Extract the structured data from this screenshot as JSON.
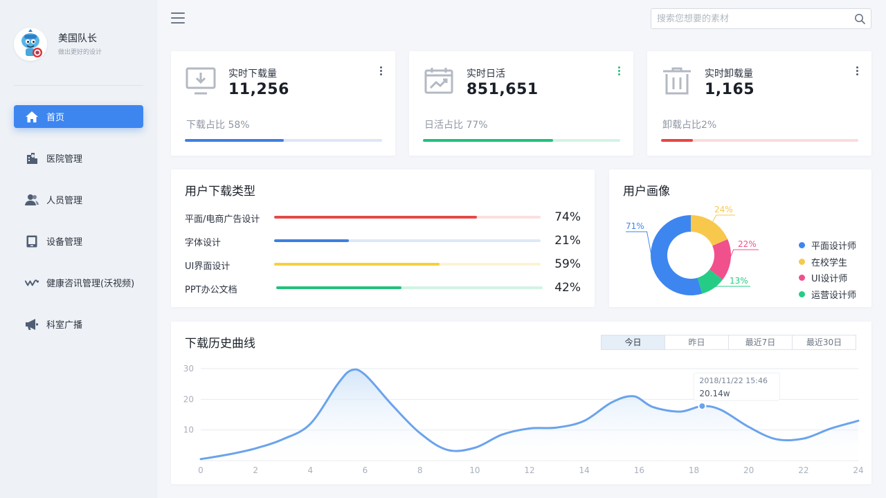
{
  "brand": {
    "name": "美国队长",
    "subtitle": "做出更好的设计"
  },
  "nav": {
    "items": [
      {
        "label": "首页",
        "icon": "home-icon"
      },
      {
        "label": "医院管理",
        "icon": "hospital-icon"
      },
      {
        "label": "人员管理",
        "icon": "users-icon"
      },
      {
        "label": "设备管理",
        "icon": "tablet-icon"
      },
      {
        "label": "健康咨讯管理(沃视频)",
        "icon": "wave-icon"
      },
      {
        "label": "科室广播",
        "icon": "megaphone-icon"
      }
    ],
    "active_index": 0
  },
  "search": {
    "placeholder": "搜索您想要的素材",
    "value": ""
  },
  "stats": [
    {
      "title": "实时下载量",
      "value": "11,256",
      "footer": "下载占比 58%",
      "progress": 0.5,
      "color": "#3d7fe0",
      "track": "#dce7f6",
      "icon": "download-monitor-icon"
    },
    {
      "title": "实时日活",
      "value": "851,651",
      "footer": "日活占比 77%",
      "progress": 0.66,
      "color": "#20c07a",
      "track": "#d3f3e4",
      "icon": "calendar-trend-icon"
    },
    {
      "title": "实时卸载量",
      "value": "1,165",
      "footer": "卸载占比2%",
      "progress": 0.16,
      "color": "#e64545",
      "track": "#fbdcdc",
      "icon": "trash-icon"
    }
  ],
  "download_types": {
    "title": "用户下载类型",
    "rows": [
      {
        "label": "平面/电商广告设计",
        "pct": "74%",
        "value": 0.76,
        "color": "#e34a4a",
        "track": "#fbdfdf"
      },
      {
        "label": "字体设计",
        "pct": "21%",
        "value": 0.28,
        "color": "#3d7fe0",
        "track": "#dde8f7"
      },
      {
        "label": "UI界面设计",
        "pct": "59%",
        "value": 0.62,
        "color": "#f4d13d",
        "track": "#fdf3d2"
      },
      {
        "label": "PPT办公文档",
        "pct": "42%",
        "value": 0.47,
        "color": "#22c17a",
        "track": "#d2f3e3"
      }
    ]
  },
  "persona": {
    "title": "用户画像",
    "slices": [
      {
        "name": "平面设计师",
        "label": "71%",
        "value": 71,
        "color": "#3d86f0"
      },
      {
        "name": "在校学生",
        "label": "24%",
        "value": 24,
        "color": "#f7c84c"
      },
      {
        "name": "UI设计师",
        "label": "22%",
        "value": 22,
        "color": "#f0508c"
      },
      {
        "name": "运营设计师",
        "label": "13%",
        "value": 13,
        "color": "#26cc85"
      }
    ]
  },
  "history": {
    "title": "下载历史曲线",
    "tabs": [
      "今日",
      "昨日",
      "最近7日",
      "最近30日"
    ],
    "active_tab": 0,
    "tooltip": {
      "time": "2018/11/22 15:46",
      "value": "20.14w"
    }
  },
  "chart_data": {
    "type": "area",
    "x": [
      0,
      1,
      2,
      3,
      4,
      5,
      5.5,
      6,
      7,
      8,
      9,
      10,
      11,
      12,
      13,
      14,
      15,
      15.8,
      16.5,
      17.5,
      18.3,
      19,
      20,
      21,
      22,
      23,
      24
    ],
    "values": [
      0.5,
      2,
      4,
      7,
      12,
      25,
      29.5,
      28,
      18,
      9,
      3.5,
      4.2,
      8.5,
      10.5,
      10.8,
      13,
      19,
      21,
      17.5,
      16,
      17.8,
      16.5,
      11,
      7,
      7.2,
      10.5,
      13
    ],
    "xticks": [
      0,
      2,
      4,
      6,
      8,
      10,
      12,
      14,
      16,
      18,
      20,
      22,
      24
    ],
    "yticks": [
      10,
      20,
      30
    ],
    "xlim": [
      0,
      24
    ],
    "ylim": [
      0,
      30
    ],
    "highlight": {
      "x": 18.3,
      "y": 17.8
    },
    "color": "#6aa3ec",
    "grid": true
  },
  "colors": {
    "accent": "#3d86f0",
    "sidebar_bg": "#eef1f5"
  }
}
